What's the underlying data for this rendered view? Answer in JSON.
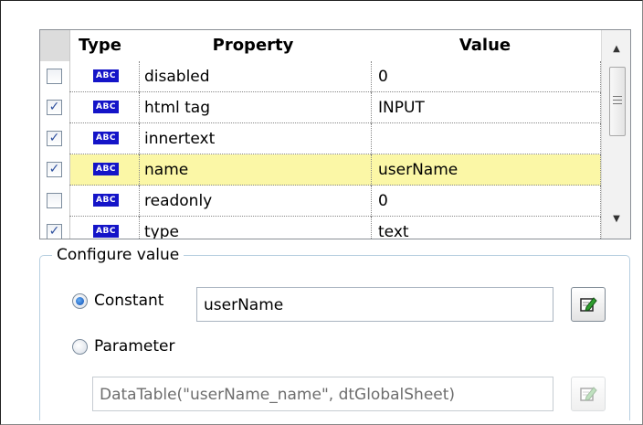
{
  "grid": {
    "headers": {
      "type": "Type",
      "property": "Property",
      "value": "Value"
    },
    "rows": [
      {
        "checked": "",
        "type_icon": "ABC",
        "property": "disabled",
        "value": "0"
      },
      {
        "checked": "✓",
        "type_icon": "ABC",
        "property": "html tag",
        "value": "INPUT"
      },
      {
        "checked": "✓",
        "type_icon": "ABC",
        "property": "innertext",
        "value": ""
      },
      {
        "checked": "✓",
        "type_icon": "ABC",
        "property": "name",
        "value": "userName"
      },
      {
        "checked": "",
        "type_icon": "ABC",
        "property": "readonly",
        "value": "0"
      },
      {
        "checked": "✓",
        "type_icon": "ABC",
        "property": "type",
        "value": "text"
      }
    ],
    "selected_row_color": "#fbf7a6",
    "scroll_up_glyph": "▲",
    "scroll_down_glyph": "▼"
  },
  "configure": {
    "legend": "Configure value",
    "constant_label": "Constant",
    "constant_value": "userName",
    "parameter_label": "Parameter",
    "parameter_value": "DataTable(\"userName_name\", dtGlobalSheet)",
    "selected_option": "Constant",
    "edit_icon": "edit-pencil-icon"
  },
  "colors": {
    "abc_badge": "#1414c8",
    "checkmark": "#2d4f9e",
    "group_border": "#b7cfe0"
  }
}
